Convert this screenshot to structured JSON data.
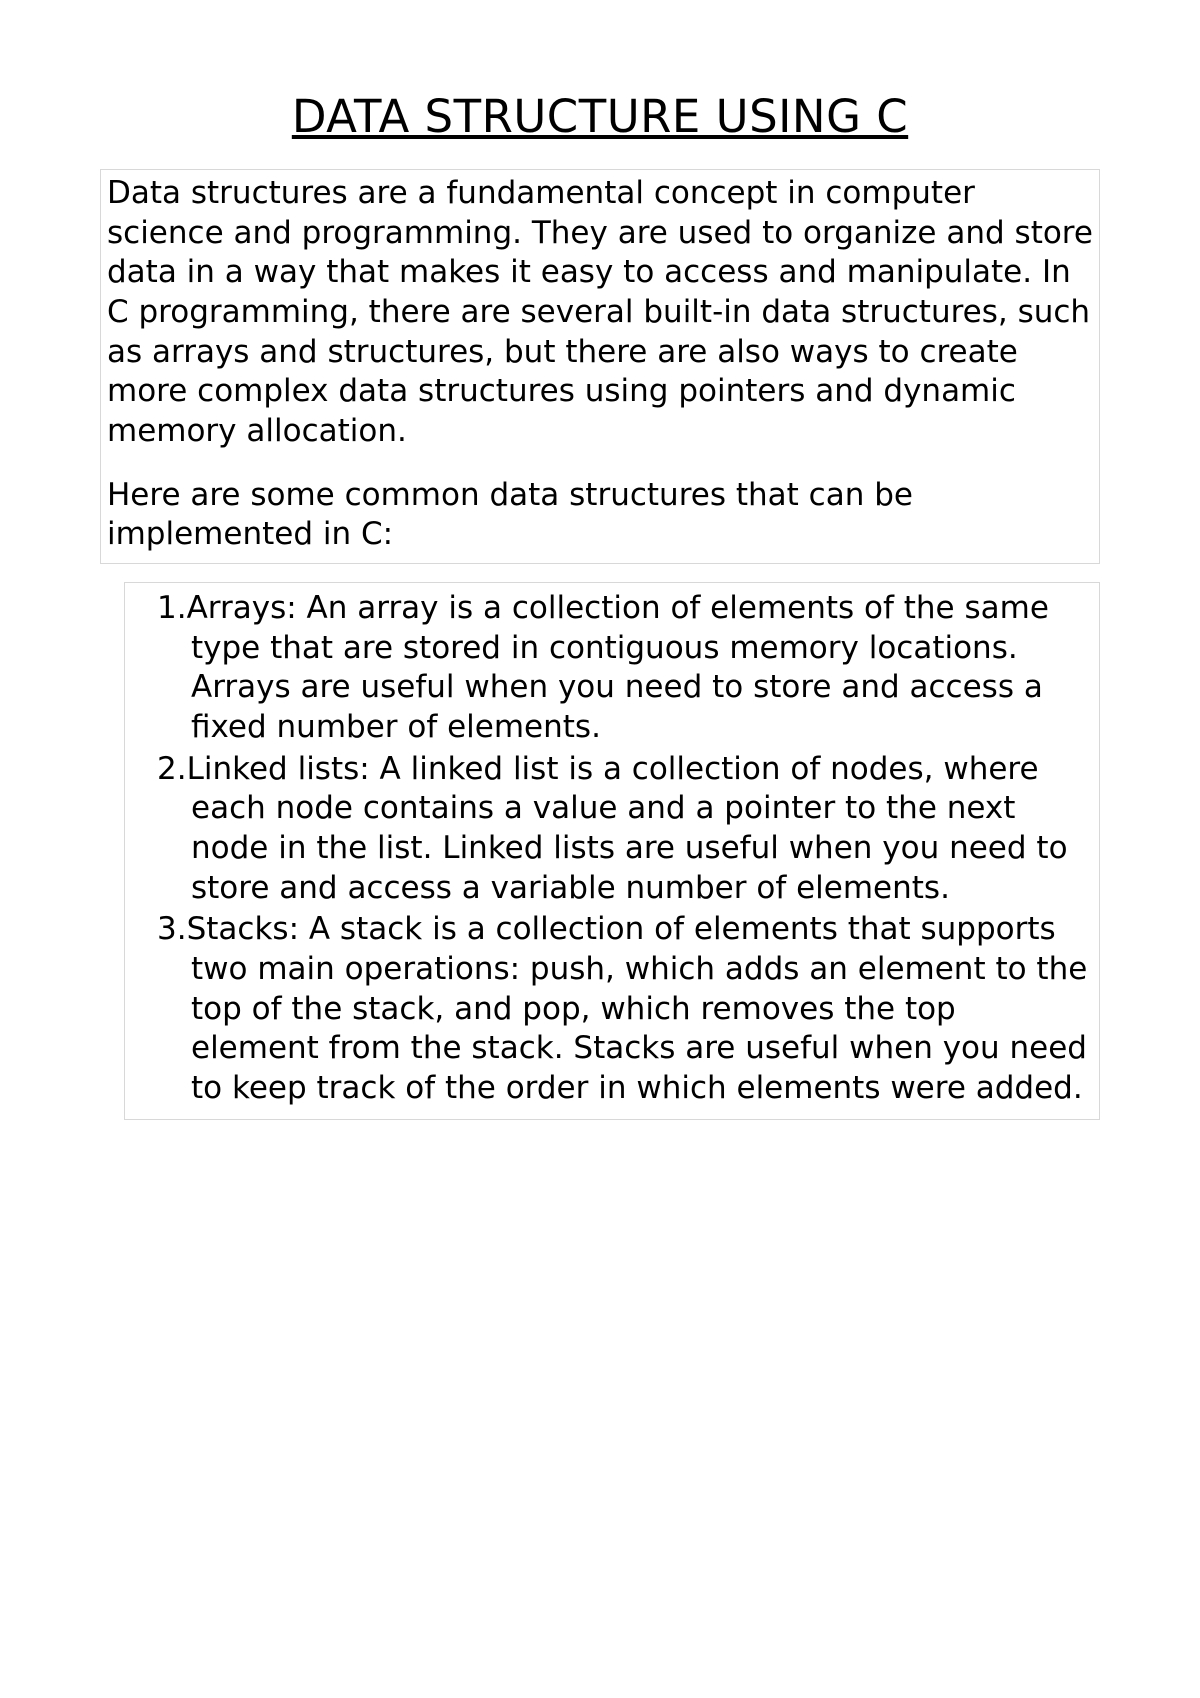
{
  "title": "DATA STRUCTURE USING C",
  "intro": {
    "p1": "Data structures are a fundamental concept in computer science and programming. They are used to organize and store data in a way that makes it easy to access and manipulate. In C programming, there are several built-in data structures, such as arrays and structures, but there are also ways to create more complex data structures using pointers and dynamic memory allocation.",
    "p2": "Here are some common data structures that can be implemented in C:"
  },
  "items": [
    "Arrays: An array is a collection of elements of the same type that are stored in contiguous memory locations. Arrays are useful when you need to store and access a fixed number of elements.",
    "Linked lists: A linked list is a collection of nodes, where each node contains a value and a pointer to the next node in the list. Linked lists are useful when you need to store and access a variable number of elements.",
    "Stacks: A stack is a collection of elements that supports two main operations: push, which adds an element to the top of the stack, and pop, which removes the top element from the stack. Stacks are useful when you need to keep track of the order in which elements were added."
  ]
}
